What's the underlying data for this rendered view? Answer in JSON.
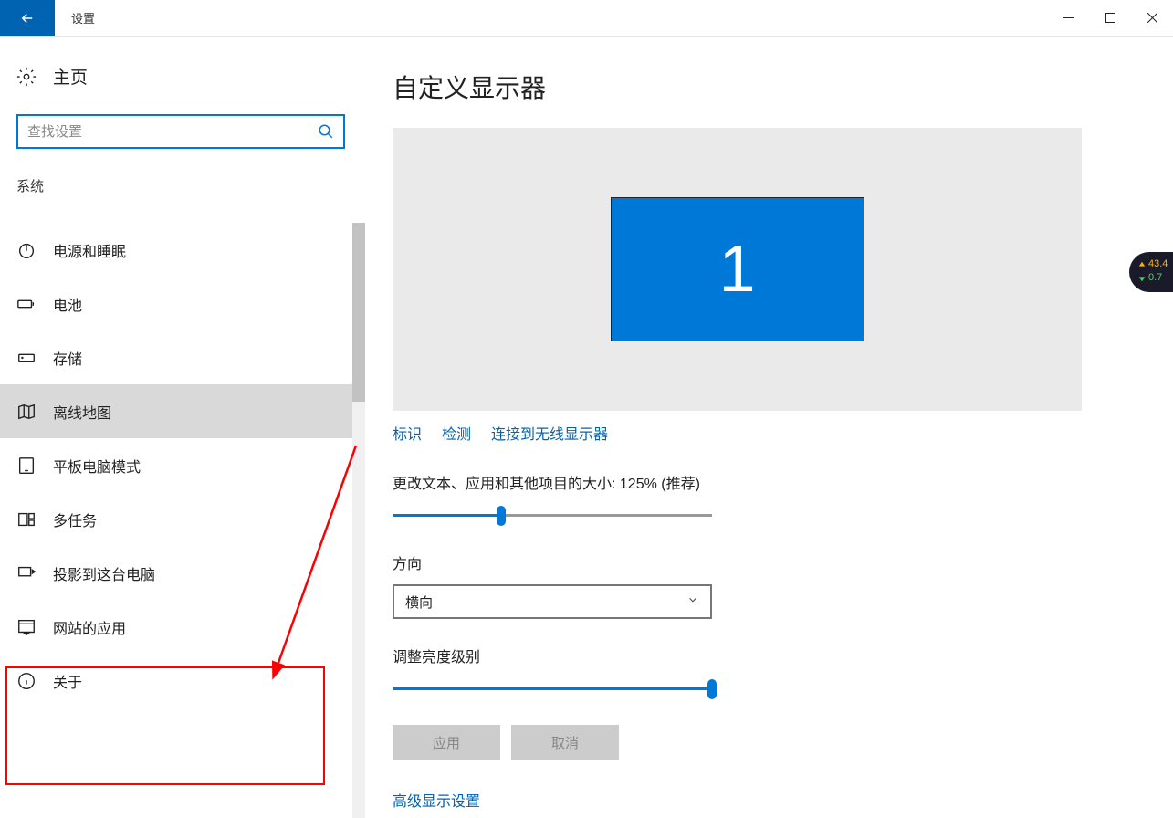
{
  "titlebar": {
    "title": "设置"
  },
  "sidebar": {
    "home_label": "主页",
    "search_placeholder": "查找设置",
    "section_label": "系统",
    "items": [
      {
        "label": "电源和睡眠",
        "icon": "power"
      },
      {
        "label": "电池",
        "icon": "battery"
      },
      {
        "label": "存储",
        "icon": "storage"
      },
      {
        "label": "离线地图",
        "icon": "map",
        "selected": true
      },
      {
        "label": "平板电脑模式",
        "icon": "tablet"
      },
      {
        "label": "多任务",
        "icon": "multitask"
      },
      {
        "label": "投影到这台电脑",
        "icon": "project"
      },
      {
        "label": "网站的应用",
        "icon": "web-apps"
      },
      {
        "label": "关于",
        "icon": "about"
      }
    ]
  },
  "main": {
    "title": "自定义显示器",
    "monitor_number": "1",
    "links": {
      "identify": "标识",
      "detect": "检测",
      "wireless": "连接到无线显示器"
    },
    "scale_label": "更改文本、应用和其他项目的大小: 125% (推荐)",
    "scale_percent": 34,
    "orientation_label": "方向",
    "orientation_value": "横向",
    "brightness_label": "调整亮度级别",
    "brightness_percent": 100,
    "apply_btn": "应用",
    "cancel_btn": "取消",
    "advanced_link": "高级显示设置"
  },
  "net_widget": {
    "up": "43.4",
    "down": "0.7"
  }
}
